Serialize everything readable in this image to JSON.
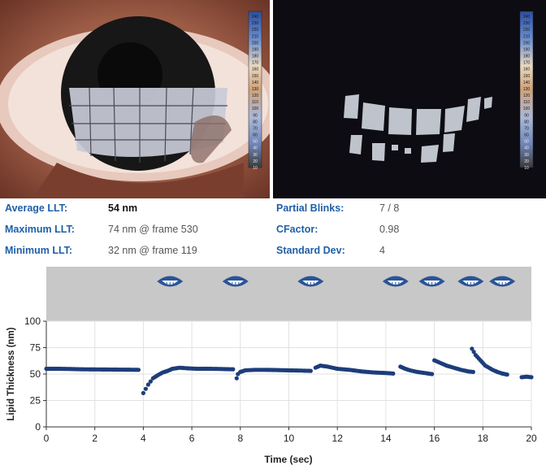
{
  "stats": {
    "average_llt_label": "Average LLT:",
    "average_llt_value": "54 nm",
    "maximum_llt_label": "Maximum LLT:",
    "maximum_llt_value": "74 nm @ frame 530",
    "minimum_llt_label": "Minimum LLT:",
    "minimum_llt_value": "32 nm @ frame 119",
    "partial_blinks_label": "Partial Blinks:",
    "partial_blinks_value": "7 / 8",
    "cfactor_label": "CFactor:",
    "cfactor_value": "0.98",
    "std_dev_label": "Standard Dev:",
    "std_dev_value": "4"
  },
  "color_scale": {
    "ticks": [
      "240",
      "230",
      "220",
      "210",
      "200",
      "190",
      "180",
      "170",
      "160",
      "150",
      "140",
      "130",
      "120",
      "110",
      "100",
      "90",
      "80",
      "70",
      "60",
      "50",
      "40",
      "30",
      "20",
      "10"
    ]
  },
  "colors": {
    "accent_blue": "#1f5fa8",
    "series": "#1d3d7a",
    "blink_band": "#c8c8c8"
  },
  "chart_data": {
    "type": "scatter",
    "xlabel": "Time (sec)",
    "ylabel": "Lipid Thickness (nm)",
    "xlim": [
      0,
      20
    ],
    "ylim": [
      0,
      100
    ],
    "xticks": [
      "0",
      "2",
      "4",
      "6",
      "8",
      "10",
      "12",
      "14",
      "16",
      "18",
      "20"
    ],
    "yticks": [
      "0",
      "25",
      "50",
      "75",
      "100"
    ],
    "grid": true,
    "blink_events_sec": [
      5.1,
      7.8,
      10.9,
      14.4,
      15.9,
      17.5,
      18.8
    ],
    "series": [
      {
        "values": [
          [
            0.0,
            55
          ],
          [
            0.5,
            55
          ],
          [
            1.0,
            54.8
          ],
          [
            1.5,
            54.5
          ],
          [
            2.0,
            54.4
          ],
          [
            2.5,
            54.3
          ],
          [
            3.0,
            54.2
          ],
          [
            3.5,
            54.1
          ],
          [
            3.8,
            54
          ]
        ]
      },
      {
        "values": [
          [
            4.0,
            32
          ],
          [
            4.1,
            36
          ],
          [
            4.2,
            40
          ],
          [
            4.3,
            43
          ],
          [
            4.4,
            46
          ],
          [
            4.6,
            49
          ],
          [
            4.8,
            51.5
          ],
          [
            5.0,
            53
          ],
          [
            5.2,
            55
          ],
          [
            5.5,
            56
          ],
          [
            5.8,
            55.5
          ],
          [
            6.2,
            55
          ],
          [
            6.8,
            55
          ],
          [
            7.2,
            54.8
          ],
          [
            7.7,
            54.5
          ]
        ]
      },
      {
        "values": [
          [
            7.85,
            46
          ],
          [
            7.9,
            50
          ],
          [
            8.0,
            52
          ],
          [
            8.2,
            53.5
          ],
          [
            8.6,
            54
          ],
          [
            9.0,
            54
          ],
          [
            9.5,
            53.8
          ],
          [
            10.0,
            53.5
          ],
          [
            10.5,
            53.3
          ],
          [
            10.9,
            53
          ]
        ]
      },
      {
        "values": [
          [
            11.1,
            56
          ],
          [
            11.3,
            58
          ],
          [
            11.6,
            57
          ],
          [
            12.0,
            55
          ],
          [
            12.5,
            54
          ],
          [
            13.0,
            52.5
          ],
          [
            13.5,
            51.5
          ],
          [
            14.0,
            51
          ],
          [
            14.3,
            50.5
          ]
        ]
      },
      {
        "values": [
          [
            14.6,
            57
          ],
          [
            14.8,
            55
          ],
          [
            15.0,
            53.5
          ],
          [
            15.3,
            52
          ],
          [
            15.6,
            51
          ],
          [
            15.9,
            50
          ]
        ]
      },
      {
        "values": [
          [
            16.0,
            63
          ],
          [
            16.2,
            61
          ],
          [
            16.5,
            58
          ],
          [
            16.8,
            56
          ],
          [
            17.1,
            54
          ],
          [
            17.4,
            52.5
          ],
          [
            17.6,
            52
          ]
        ]
      },
      {
        "values": [
          [
            17.55,
            74
          ],
          [
            17.7,
            68
          ],
          [
            17.9,
            63
          ],
          [
            18.1,
            58
          ],
          [
            18.4,
            54
          ],
          [
            18.6,
            52
          ],
          [
            18.8,
            50.5
          ],
          [
            19.0,
            49.5
          ]
        ]
      },
      {
        "values": [
          [
            19.6,
            47
          ],
          [
            19.8,
            47.5
          ],
          [
            20.0,
            47
          ]
        ]
      }
    ]
  }
}
